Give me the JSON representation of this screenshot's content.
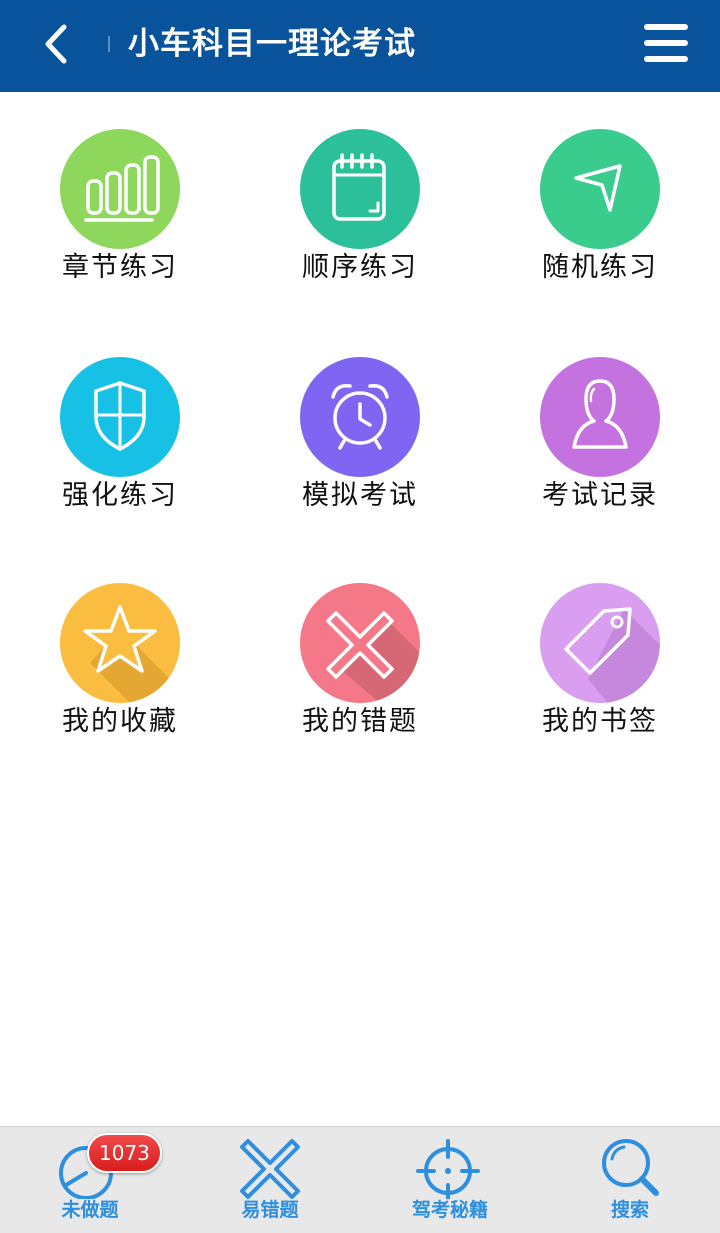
{
  "header": {
    "title": "小车科目一理论考试"
  },
  "tiles": [
    {
      "label": "章节练习",
      "icon": "bar-chart-icon",
      "color": "#8cd75c"
    },
    {
      "label": "顺序练习",
      "icon": "notepad-icon",
      "color": "#2cc09a"
    },
    {
      "label": "随机练习",
      "icon": "arrow-pointer-icon",
      "color": "#39cc8c"
    },
    {
      "label": "强化练习",
      "icon": "shield-icon",
      "color": "#17c1e6"
    },
    {
      "label": "模拟考试",
      "icon": "alarm-clock-icon",
      "color": "#7f66f2"
    },
    {
      "label": "考试记录",
      "icon": "person-icon",
      "color": "#c472e0"
    },
    {
      "label": "我的收藏",
      "icon": "star-icon",
      "color": "#fbbd3f"
    },
    {
      "label": "我的错题",
      "icon": "x-mark-icon",
      "color": "#f47888"
    },
    {
      "label": "我的书签",
      "icon": "tag-icon",
      "color": "#d99ef0"
    }
  ],
  "bottom_nav": [
    {
      "label": "未做题",
      "icon": "clock-icon",
      "badge": "1073"
    },
    {
      "label": "易错题",
      "icon": "x-mark-icon"
    },
    {
      "label": "驾考秘籍",
      "icon": "crosshair-icon"
    },
    {
      "label": "搜索",
      "icon": "search-icon"
    }
  ],
  "colors": {
    "header_bg": "#08539b",
    "bottom_accent": "#2f8fdf",
    "badge": "#e02828"
  }
}
